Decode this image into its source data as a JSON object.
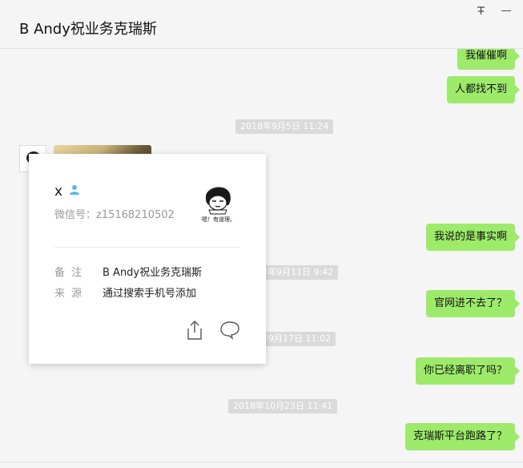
{
  "window": {
    "pin_glyph": "pin-icon",
    "minimize_glyph": "—"
  },
  "chat": {
    "title": "B   Andy祝业务克瑞斯"
  },
  "messages": [
    {
      "type": "sent",
      "text": "我催催啊"
    },
    {
      "type": "sent",
      "text": "人都找不到"
    },
    {
      "type": "time",
      "text": "2018年9月5日 11:24"
    },
    {
      "type": "received_image"
    },
    {
      "type": "sent",
      "text": "我说的是事实啊"
    },
    {
      "type": "time",
      "text": "2018年9月11日 9:42"
    },
    {
      "type": "sent",
      "text": "官网进不去了？"
    },
    {
      "type": "time",
      "text": "2018年9月17日 11:02"
    },
    {
      "type": "sent",
      "text": "你已经离职了吗？"
    },
    {
      "type": "time",
      "text": "2018年10月23日 11:41"
    },
    {
      "type": "sent",
      "text": "克瑞斯平台跑路了？"
    }
  ],
  "profile": {
    "name": "x",
    "wechat_id": "微信号：z15168210502",
    "avatar_caption": "嗯！有道理。",
    "remark_label": "备注",
    "remark_value": "B   Andy祝业务克瑞斯",
    "source_label": "来源",
    "source_value": "通过搜索手机号添加",
    "colors": {
      "gender_icon": "#5ab6e8"
    },
    "icons": [
      "gender-male-icon",
      "share-icon",
      "chat-bubble-icon"
    ]
  },
  "colors": {
    "bubble": "#9eea6a",
    "timestamp_bg": "#dadada",
    "background": "#f5f5f5"
  }
}
